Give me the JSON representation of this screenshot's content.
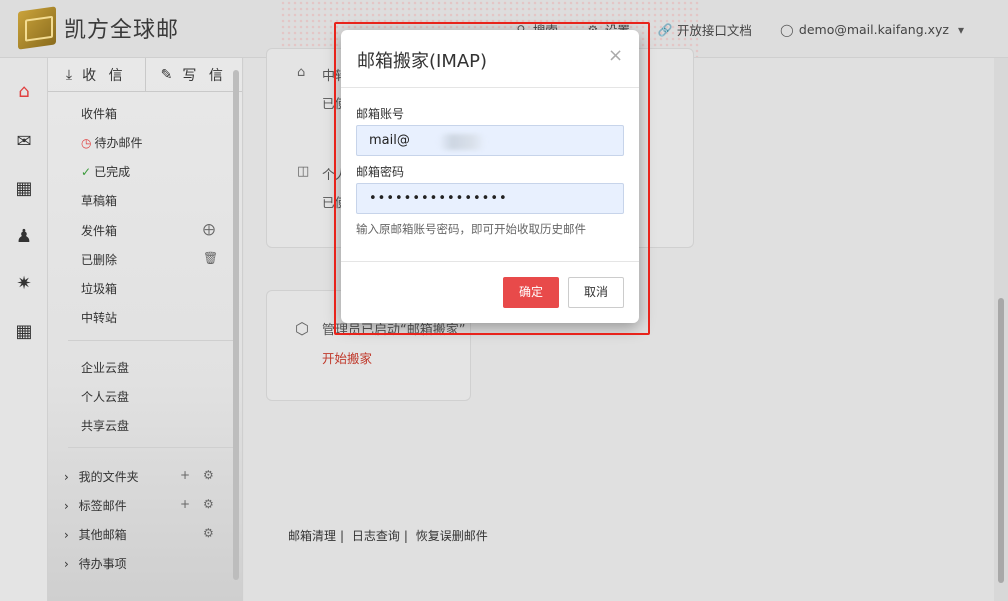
{
  "app": {
    "name": "凯方全球邮"
  },
  "topbar": {
    "search_label": "搜索",
    "settings_label": "设置",
    "api_docs_label": "开放接口文档",
    "account_label": "demo@mail.kaifang.xyz"
  },
  "sidebar": {
    "receive_label": "收 信",
    "compose_label": "写 信",
    "folders": [
      {
        "label": "收件箱"
      },
      {
        "label": "待办邮件"
      },
      {
        "label": "已完成"
      },
      {
        "label": "草稿箱"
      },
      {
        "label": "发件箱"
      },
      {
        "label": "已删除"
      },
      {
        "label": "垃圾箱"
      },
      {
        "label": "中转站"
      }
    ],
    "clouds": [
      {
        "label": "企业云盘"
      },
      {
        "label": "个人云盘"
      },
      {
        "label": "共享云盘"
      }
    ],
    "groups": [
      {
        "label": "我的文件夹"
      },
      {
        "label": "标签邮件"
      },
      {
        "label": "其他邮箱"
      },
      {
        "label": "待办事项"
      }
    ]
  },
  "main": {
    "card1_title": "中转",
    "card1_status": "已使",
    "card2_title": "个人",
    "card2_status": "已使",
    "card3_title": "管理员已启动“邮箱搬家”",
    "card3_link": "开始搬家",
    "footer_links": [
      "邮箱清理",
      "日志查询",
      "恢复误删邮件"
    ]
  },
  "modal": {
    "title": "邮箱搬家(IMAP)",
    "account_label": "邮箱账号",
    "account_value": "mail@",
    "password_label": "邮箱密码",
    "password_value": "••••••••••••••••",
    "hint": "输入原邮箱账号密码，即可开始收取历史邮件",
    "ok_label": "确定",
    "cancel_label": "取消"
  },
  "colors": {
    "accent": "#e84a4a",
    "highlight": "#e8231b",
    "link": "#c0392b"
  }
}
